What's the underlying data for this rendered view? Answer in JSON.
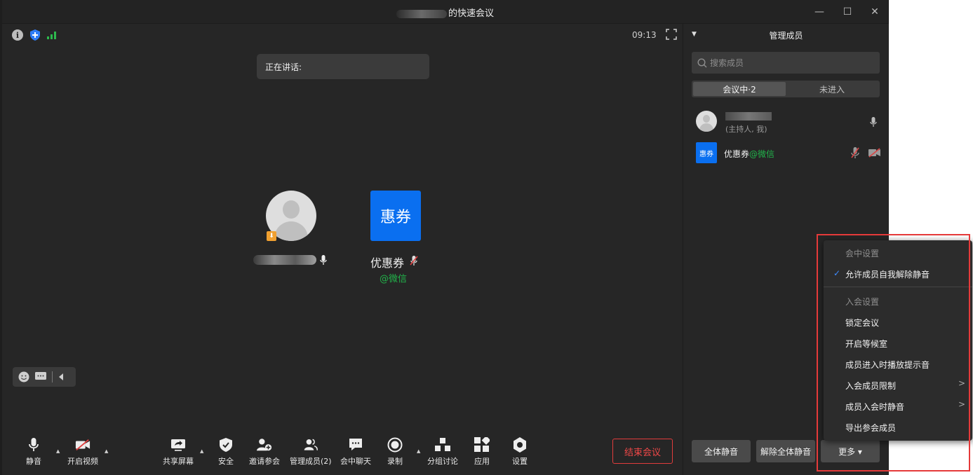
{
  "window": {
    "title_suffix": "的快速会议",
    "controls": [
      "—",
      "☐",
      "✕"
    ]
  },
  "stage": {
    "clock": "09:13",
    "speaking_label": "正在讲话:",
    "participants": [
      {
        "name": "优惠券",
        "sub": "@微信",
        "tile_text": "惠券"
      }
    ]
  },
  "toolbar": {
    "mute": "静音",
    "video": "开启视频",
    "share": "共享屏幕",
    "security": "安全",
    "invite": "邀请参会",
    "manage": "管理成员(2)",
    "chat": "会中聊天",
    "record": "录制",
    "breakout": "分组讨论",
    "apps": "应用",
    "settings": "设置",
    "end": "结束会议"
  },
  "panel": {
    "title": "管理成员",
    "search_placeholder": "搜索成员",
    "tabs": [
      "会议中·2",
      "未进入"
    ],
    "members": [
      {
        "role": "(主持人, 我)"
      },
      {
        "tile_text": "惠券",
        "name": "优惠券",
        "sub": "@微信"
      }
    ],
    "mute_all": "全体静音",
    "unmute_all": "解除全体静音",
    "more": "更多 ▾"
  },
  "dropdown": {
    "section1": "会中设置",
    "allow_unmute": "允许成员自我解除静音",
    "section2": "入会设置",
    "lock": "锁定会议",
    "waiting_room": "开启等候室",
    "join_sound": "成员进入时播放提示音",
    "member_limit": "入会成员限制",
    "mute_on_join": "成员入会时静音",
    "export": "导出参会成员"
  },
  "colors": {
    "accent": "#0a6ff0",
    "wechat_green": "#21b34a",
    "end_red": "#e03c3c",
    "highlight_red": "#e53a3a"
  }
}
